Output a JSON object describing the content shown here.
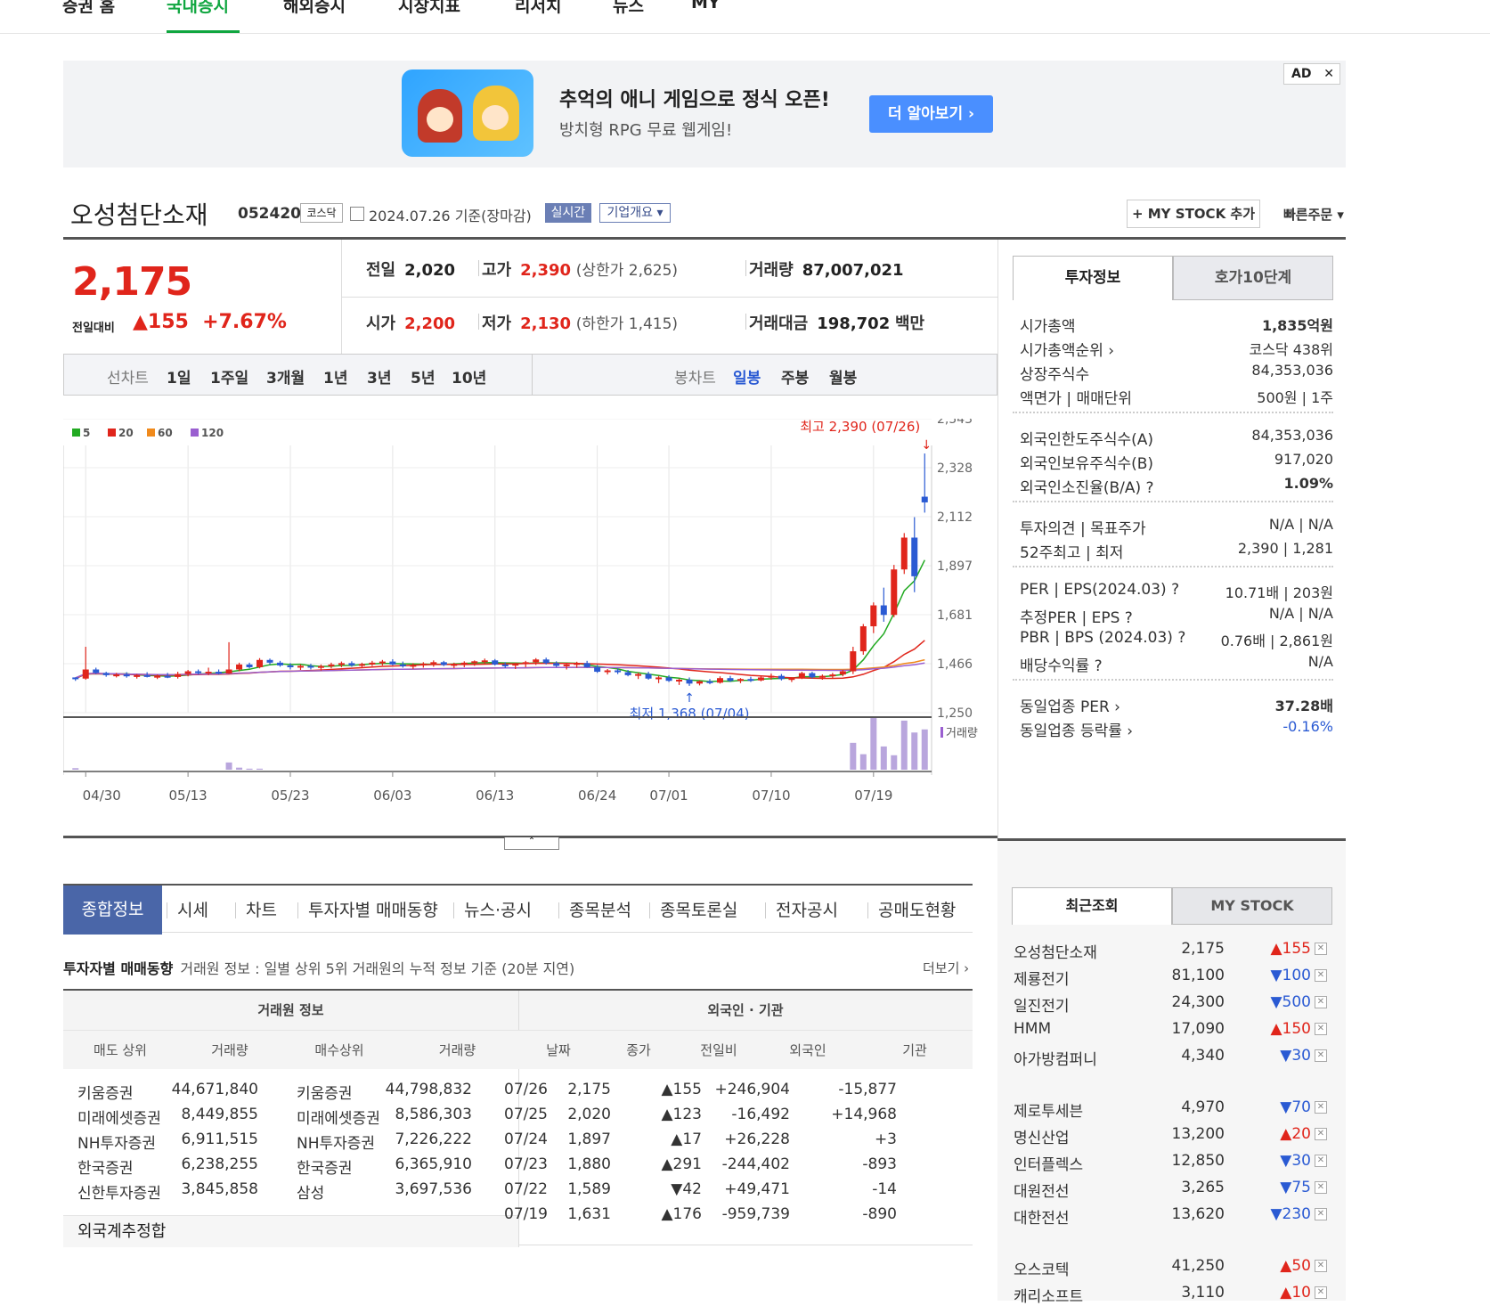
{
  "nav": {
    "items": [
      "증권 홈",
      "국내증시",
      "해외증시",
      "시장지표",
      "리서치",
      "뉴스",
      "MY"
    ],
    "active": 1
  },
  "ad": {
    "headline": "추억의 애니 게임으로 정식 오픈!",
    "sub": "방치형 RPG 무료 웹게임!",
    "cta": "더 알아보기 ›",
    "badge": "AD",
    "close": "✕"
  },
  "stock": {
    "name": "오성첨단소재",
    "code": "052420",
    "market": "코스닥",
    "date": "2024.07.26 기준(장마감)",
    "realtime": "실시간",
    "company": "기업개요 ▾",
    "my_stock": "+ MY STOCK 추가",
    "fast_order": "빠른주문 ▾"
  },
  "price": {
    "current": "2,175",
    "chg_label": "전일대비",
    "chg": "▲155",
    "chg_pct": "+7.67%",
    "prev_label": "전일",
    "prev": "2,020",
    "high_label": "고가",
    "high": "2,390",
    "upper": "(상한가 2,625)",
    "vol_label": "거래량",
    "vol": "87,007,021",
    "open_label": "시가",
    "open": "2,200",
    "low_label": "저가",
    "low": "2,130",
    "lower": "(하한가 1,415)",
    "amt_label": "거래대금",
    "amt": "198,702",
    "amt_unit": "백만"
  },
  "chart_tabs": {
    "line_label": "선차트",
    "line": [
      "1일",
      "1주일",
      "3개월",
      "1년",
      "3년",
      "5년",
      "10년"
    ],
    "candle_label": "봉차트",
    "candle": [
      "일봉",
      "주봉",
      "월봉"
    ],
    "candle_active": 0
  },
  "chart_data": {
    "type": "candlestick",
    "legend": [
      "5",
      "20",
      "60",
      "120"
    ],
    "legend_colors": [
      "#22aa22",
      "#e0251b",
      "#f08a1c",
      "#9a5fd0"
    ],
    "y_ticks": [
      "2,543",
      "2,328",
      "2,112",
      "1,897",
      "1,681",
      "1,466",
      "1,250"
    ],
    "ylim": [
      1250,
      2543
    ],
    "x_ticks": [
      "04/30",
      "05/13",
      "05/23",
      "06/03",
      "06/13",
      "06/24",
      "07/01",
      "07/10",
      "07/19"
    ],
    "x_tick_index": [
      1,
      11,
      21,
      31,
      41,
      51,
      58,
      68,
      78
    ],
    "high_label": "최고 2,390 (07/26)",
    "low_label": "최저 1,368 (07/04)",
    "volume_label": "거래량",
    "candles": [
      [
        1405,
        1405,
        1390,
        1400
      ],
      [
        1400,
        1540,
        1395,
        1440
      ],
      [
        1440,
        1448,
        1420,
        1425
      ],
      [
        1425,
        1430,
        1408,
        1415
      ],
      [
        1415,
        1425,
        1405,
        1418
      ],
      [
        1418,
        1428,
        1404,
        1410
      ],
      [
        1410,
        1420,
        1400,
        1415
      ],
      [
        1415,
        1428,
        1405,
        1408
      ],
      [
        1408,
        1418,
        1398,
        1412
      ],
      [
        1412,
        1425,
        1402,
        1407
      ],
      [
        1407,
        1430,
        1400,
        1420
      ],
      [
        1420,
        1438,
        1410,
        1432
      ],
      [
        1432,
        1440,
        1418,
        1425
      ],
      [
        1425,
        1448,
        1415,
        1430
      ],
      [
        1430,
        1440,
        1418,
        1422
      ],
      [
        1422,
        1560,
        1420,
        1440
      ],
      [
        1440,
        1470,
        1432,
        1462
      ],
      [
        1462,
        1470,
        1445,
        1450
      ],
      [
        1450,
        1490,
        1445,
        1482
      ],
      [
        1482,
        1488,
        1462,
        1470
      ],
      [
        1470,
        1478,
        1452,
        1458
      ],
      [
        1458,
        1468,
        1440,
        1450
      ],
      [
        1450,
        1462,
        1438,
        1456
      ],
      [
        1456,
        1465,
        1440,
        1448
      ],
      [
        1448,
        1462,
        1435,
        1455
      ],
      [
        1455,
        1470,
        1445,
        1462
      ],
      [
        1462,
        1475,
        1450,
        1468
      ],
      [
        1468,
        1476,
        1452,
        1458
      ],
      [
        1458,
        1470,
        1448,
        1464
      ],
      [
        1464,
        1478,
        1455,
        1470
      ],
      [
        1470,
        1482,
        1458,
        1475
      ],
      [
        1475,
        1485,
        1458,
        1462
      ],
      [
        1462,
        1475,
        1448,
        1455
      ],
      [
        1455,
        1468,
        1442,
        1460
      ],
      [
        1460,
        1472,
        1448,
        1466
      ],
      [
        1466,
        1480,
        1452,
        1472
      ],
      [
        1472,
        1478,
        1455,
        1460
      ],
      [
        1460,
        1470,
        1446,
        1464
      ],
      [
        1464,
        1476,
        1450,
        1470
      ],
      [
        1470,
        1480,
        1456,
        1476
      ],
      [
        1476,
        1488,
        1462,
        1480
      ],
      [
        1480,
        1486,
        1458,
        1462
      ],
      [
        1462,
        1472,
        1446,
        1458
      ],
      [
        1458,
        1470,
        1442,
        1465
      ],
      [
        1465,
        1478,
        1450,
        1472
      ],
      [
        1472,
        1490,
        1460,
        1484
      ],
      [
        1484,
        1492,
        1462,
        1468
      ],
      [
        1468,
        1476,
        1450,
        1456
      ],
      [
        1456,
        1466,
        1440,
        1462
      ],
      [
        1462,
        1474,
        1448,
        1468
      ],
      [
        1468,
        1478,
        1448,
        1450
      ],
      [
        1450,
        1460,
        1425,
        1430
      ],
      [
        1430,
        1442,
        1418,
        1436
      ],
      [
        1436,
        1445,
        1420,
        1428
      ],
      [
        1428,
        1438,
        1410,
        1415
      ],
      [
        1415,
        1426,
        1398,
        1420
      ],
      [
        1420,
        1430,
        1395,
        1400
      ],
      [
        1400,
        1412,
        1380,
        1405
      ],
      [
        1405,
        1415,
        1385,
        1390
      ],
      [
        1390,
        1400,
        1372,
        1395
      ],
      [
        1395,
        1405,
        1368,
        1378
      ],
      [
        1378,
        1392,
        1370,
        1388
      ],
      [
        1388,
        1398,
        1375,
        1382
      ],
      [
        1382,
        1410,
        1378,
        1402
      ],
      [
        1402,
        1412,
        1385,
        1390
      ],
      [
        1390,
        1402,
        1380,
        1398
      ],
      [
        1398,
        1408,
        1385,
        1392
      ],
      [
        1392,
        1412,
        1388,
        1405
      ],
      [
        1405,
        1422,
        1395,
        1412
      ],
      [
        1412,
        1420,
        1392,
        1398
      ],
      [
        1398,
        1406,
        1385,
        1402
      ],
      [
        1402,
        1430,
        1398,
        1424
      ],
      [
        1424,
        1430,
        1400,
        1406
      ],
      [
        1406,
        1418,
        1395,
        1412
      ],
      [
        1412,
        1425,
        1400,
        1418
      ],
      [
        1418,
        1438,
        1410,
        1432
      ],
      [
        1432,
        1540,
        1420,
        1520
      ],
      [
        1520,
        1640,
        1505,
        1630
      ],
      [
        1630,
        1735,
        1600,
        1722
      ],
      [
        1722,
        1800,
        1650,
        1680
      ],
      [
        1680,
        1900,
        1670,
        1880
      ],
      [
        1880,
        2040,
        1860,
        2020
      ],
      [
        2020,
        2110,
        1780,
        1850
      ],
      [
        2200,
        2390,
        2130,
        2175
      ]
    ],
    "volumes": [
      0.03,
      0,
      0,
      0,
      0,
      0,
      0,
      0,
      0,
      0,
      0,
      0,
      0,
      0,
      0,
      0.14,
      0.04,
      0.02,
      0.02,
      0,
      0,
      0,
      0,
      0,
      0,
      0,
      0,
      0,
      0,
      0,
      0,
      0,
      0,
      0,
      0,
      0,
      0,
      0,
      0,
      0,
      0,
      0,
      0,
      0,
      0,
      0,
      0,
      0,
      0,
      0,
      0,
      0,
      0,
      0,
      0,
      0,
      0,
      0,
      0,
      0,
      0,
      0,
      0,
      0,
      0,
      0,
      0,
      0,
      0,
      0,
      0,
      0,
      0,
      0,
      0,
      0,
      0.52,
      0.3,
      1.0,
      0.45,
      0.28,
      0.95,
      0.72,
      0.78
    ]
  },
  "side": {
    "tab_on": "투자정보",
    "tab_off": "호가10단계",
    "rows": [
      {
        "l": "시가총액",
        "r": "1,835억원"
      },
      {
        "l": "시가총액순위 ›",
        "r": "코스닥 438위"
      },
      {
        "l": "상장주식수",
        "r": "84,353,036"
      },
      {
        "l": "액면가 | 매매단위",
        "r": "500원 | 1주"
      },
      {
        "l": "외국인한도주식수(A)",
        "r": "84,353,036"
      },
      {
        "l": "외국인보유주식수(B)",
        "r": "917,020"
      },
      {
        "l": "외국인소진율(B/A) ?",
        "r": "1.09%"
      },
      {
        "l": "투자의견 | 목표주가",
        "r": "N/A | N/A"
      },
      {
        "l": "52주최고 | 최저",
        "r": "2,390 | 1,281"
      },
      {
        "l": "PER | EPS(2024.03) ?",
        "r": "10.71배 | 203원"
      },
      {
        "l": "추정PER | EPS ?",
        "r": "N/A | N/A"
      },
      {
        "l": "PBR | BPS (2024.03) ?",
        "r": "0.76배 | 2,861원"
      },
      {
        "l": "배당수익률 ?",
        "r": "N/A"
      },
      {
        "l": "동일업종 PER ›",
        "r": "37.28배"
      },
      {
        "l": "동일업종 등락률 ›",
        "r": "-0.16%"
      }
    ]
  },
  "recent": {
    "tab_on": "최근조회",
    "tab_off": "MY STOCK",
    "rows": [
      {
        "n": "오성첨단소재",
        "p": "2,175",
        "c": "▲155",
        "d": "up"
      },
      {
        "n": "제룡전기",
        "p": "81,100",
        "c": "▼100",
        "d": "down"
      },
      {
        "n": "일진전기",
        "p": "24,300",
        "c": "▼500",
        "d": "down"
      },
      {
        "n": "HMM",
        "p": "17,090",
        "c": "▲150",
        "d": "up"
      },
      {
        "n": "아가방컴퍼니",
        "p": "4,340",
        "c": "▼30",
        "d": "down"
      },
      {
        "n": "제로투세븐",
        "p": "4,970",
        "c": "▼70",
        "d": "down"
      },
      {
        "n": "명신산업",
        "p": "13,200",
        "c": "▲20",
        "d": "up"
      },
      {
        "n": "인터플렉스",
        "p": "12,850",
        "c": "▼30",
        "d": "down"
      },
      {
        "n": "대원전선",
        "p": "3,265",
        "c": "▼75",
        "d": "down"
      },
      {
        "n": "대한전선",
        "p": "13,620",
        "c": "▼230",
        "d": "down"
      },
      {
        "n": "오스코텍",
        "p": "41,250",
        "c": "▲50",
        "d": "up"
      },
      {
        "n": "캐리소프트",
        "p": "3,110",
        "c": "▲10",
        "d": "up"
      }
    ]
  },
  "subtabs": [
    "종합정보",
    "시세",
    "차트",
    "투자자별 매매동향",
    "뉴스·공시",
    "종목분석",
    "종목토론실",
    "전자공시",
    "공매도현황"
  ],
  "section": {
    "title": "투자자별 매매동향",
    "desc": "거래원 정보 : 일별 상위 5위 거래원의 누적 정보 기준 (20분 지연)",
    "more": "더보기 ›"
  },
  "table": {
    "h_left": "거래원 정보",
    "h_right": "외국인 · 기관",
    "cols": [
      "매도 상위",
      "거래량",
      "매수상위",
      "거래량",
      "날짜",
      "종가",
      "전일비",
      "외국인",
      "기관"
    ],
    "brokers": [
      [
        "키움증권",
        "44,671,840",
        "키움증권",
        "44,798,832"
      ],
      [
        "미래에셋증권",
        "8,449,855",
        "미래에셋증권",
        "8,586,303"
      ],
      [
        "NH투자증권",
        "6,911,515",
        "NH투자증권",
        "7,226,222"
      ],
      [
        "한국증권",
        "6,238,255",
        "한국증권",
        "6,365,910"
      ],
      [
        "신한투자증권",
        "3,845,858",
        "삼성",
        "3,697,536"
      ]
    ],
    "foot": "외국계추정합",
    "foreign": [
      [
        "07/26",
        "2,175",
        "▲155",
        "+246,904",
        "-15,877"
      ],
      [
        "07/25",
        "2,020",
        "▲123",
        "-16,492",
        "+14,968"
      ],
      [
        "07/24",
        "1,897",
        "▲17",
        "+26,228",
        "+3"
      ],
      [
        "07/23",
        "1,880",
        "▲291",
        "-244,402",
        "-893"
      ],
      [
        "07/22",
        "1,589",
        "▼42",
        "+49,471",
        "-14"
      ],
      [
        "07/19",
        "1,631",
        "▲176",
        "-959,739",
        "-890"
      ]
    ]
  }
}
